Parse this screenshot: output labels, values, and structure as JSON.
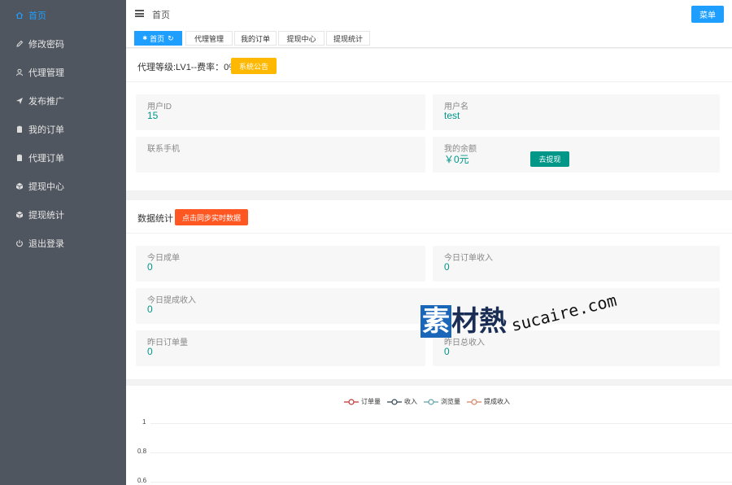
{
  "sidebar": {
    "items": [
      {
        "label": "首页",
        "icon": "home-icon",
        "active": true
      },
      {
        "label": "修改密码",
        "icon": "pencil-icon"
      },
      {
        "label": "代理管理",
        "icon": "user-icon"
      },
      {
        "label": "发布推广",
        "icon": "send-icon"
      },
      {
        "label": "我的订单",
        "icon": "clipboard-icon"
      },
      {
        "label": "代理订单",
        "icon": "clipboard-icon"
      },
      {
        "label": "提现中心",
        "icon": "cube-icon"
      },
      {
        "label": "提现统计",
        "icon": "cube-icon"
      },
      {
        "label": "退出登录",
        "icon": "power-icon"
      }
    ]
  },
  "header": {
    "breadcrumb": "首页",
    "menu_button": "菜单"
  },
  "tabs": [
    {
      "label": "首页",
      "active": true
    },
    {
      "label": "代理管理"
    },
    {
      "label": "我的订单"
    },
    {
      "label": "提现中心"
    },
    {
      "label": "提现统计"
    }
  ],
  "agent_panel": {
    "title": "代理等级:LV1--费率：0%",
    "notice_button": "系统公告",
    "fields": {
      "user_id_label": "用户ID",
      "user_id_value": "15",
      "username_label": "用户名",
      "username_value": "test",
      "phone_label": "联系手机",
      "phone_value": "",
      "balance_label": "我的余额",
      "balance_value": "￥0元",
      "withdraw_button": "去提现"
    }
  },
  "stats_panel": {
    "title": "数据统计",
    "sync_button": "点击同步实时数据",
    "fields": {
      "today_deals_label": "今日成单",
      "today_deals_value": "0",
      "today_order_income_label": "今日订单收入",
      "today_order_income_value": "0",
      "today_withdraw_income_label": "今日提成收入",
      "today_withdraw_income_value": "0",
      "yesterday_orders_label": "昨日订单量",
      "yesterday_orders_value": "0",
      "yesterday_total_income_label": "昨日总收入",
      "yesterday_total_income_value": "0"
    }
  },
  "chart_data": {
    "type": "line",
    "series": [
      {
        "name": "订单量",
        "color": "#c23531",
        "values": []
      },
      {
        "name": "收入",
        "color": "#2f4554",
        "values": []
      },
      {
        "name": "浏览量",
        "color": "#61a0a8",
        "values": []
      },
      {
        "name": "提成收入",
        "color": "#d48265",
        "values": []
      }
    ],
    "y_ticks": [
      "1",
      "0.8",
      "0.6"
    ],
    "title": "",
    "xlabel": "",
    "ylabel": ""
  },
  "watermark": {
    "logo": "素材熱",
    "logo_first": "素",
    "logo_rest": "材熱",
    "url": "sucaire.com"
  },
  "colors": {
    "sidebar_bg": "#50565f",
    "accent_blue": "#1e9fff",
    "teal": "#009688",
    "yellow": "#ffb800",
    "orange": "#ff5722"
  }
}
